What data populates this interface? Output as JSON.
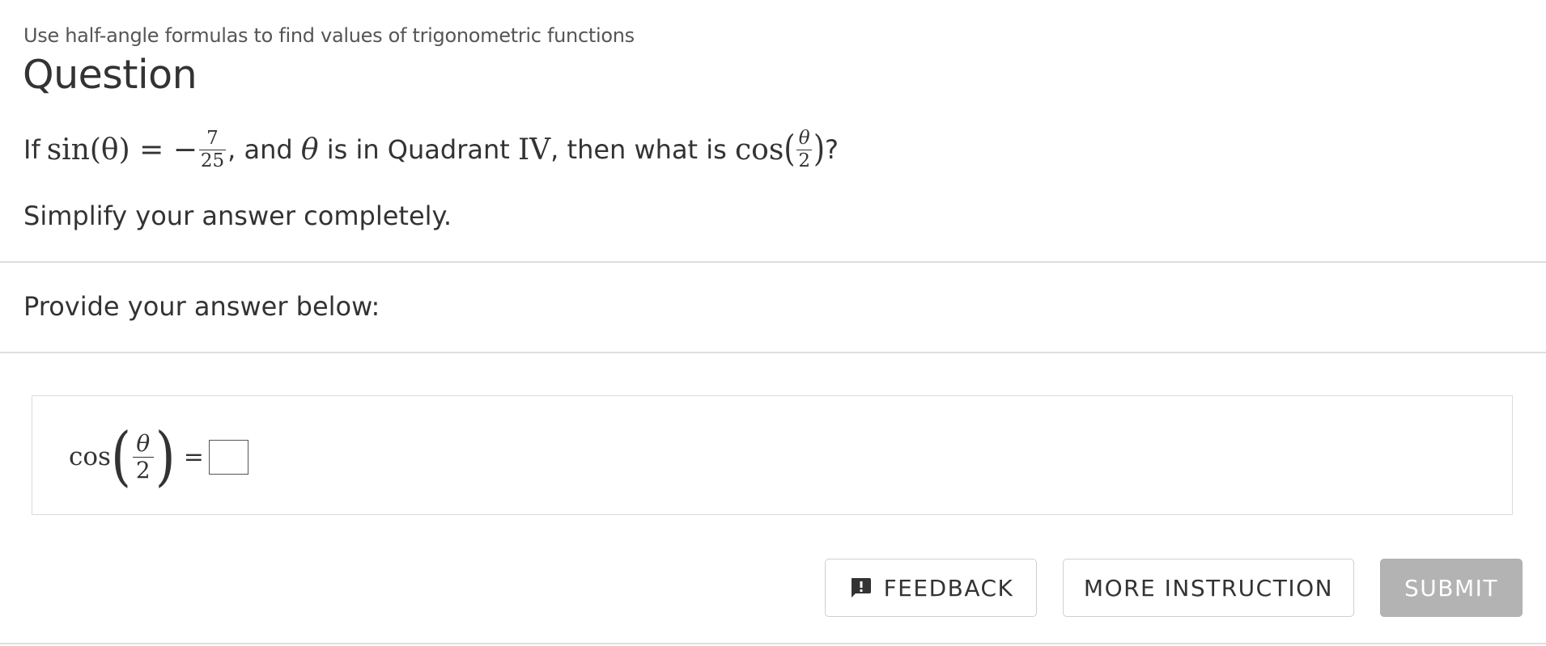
{
  "header": {
    "topic": "Use half-angle formulas to find values of trigonometric functions",
    "title": "Question"
  },
  "question": {
    "prefix": "If ",
    "sin_expr": "sin(θ) = −",
    "sin_numerator": "7",
    "sin_denominator": "25",
    "middle_1": ", and ",
    "theta": "θ",
    "middle_2": " is in Quadrant ",
    "quadrant": "IV",
    "middle_3": ", then what is ",
    "cos_fn": "cos",
    "cos_numerator": "θ",
    "cos_denominator": "2",
    "suffix": "?",
    "instruction": "Simplify your answer completely."
  },
  "answer": {
    "prompt": "Provide your answer below:",
    "fn": "cos",
    "numerator": "θ",
    "denominator": "2",
    "equals": "=",
    "input_value": ""
  },
  "buttons": {
    "feedback_label": "FEEDBACK",
    "more_instruction_label": "MORE INSTRUCTION",
    "submit_label": "SUBMIT"
  },
  "icons": {
    "feedback": "feedback-icon"
  },
  "colors": {
    "text": "#333333",
    "submit_bg": "#b3b3b3",
    "border": "#cfcfcf"
  }
}
